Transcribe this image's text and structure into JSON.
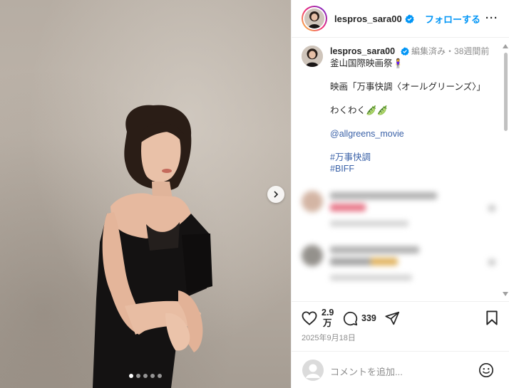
{
  "post": {
    "username": "lespros_sara00",
    "follow_label": "フォローする",
    "more_label": "···",
    "caption": {
      "meta": "編集済み・38週間前",
      "lines": [
        "釜山国際映画祭🧍‍♀️",
        "映画「万事快調〈オールグリーンズ〉」",
        "わくわく🫛🫛"
      ],
      "mention": "@allgreens_movie",
      "hashtags": [
        "#万事快調",
        "#BIFF"
      ]
    },
    "likes": [
      "2.9",
      "万"
    ],
    "comments_count": "339",
    "date": "2025年9月18日",
    "comment_placeholder": "コメントを追加..."
  },
  "carousel": {
    "slides": 5,
    "active": 0
  },
  "icons": {
    "verified": "verified-badge-icon",
    "heart": "heart-icon",
    "comment": "comment-icon",
    "share": "share-icon",
    "save": "bookmark-icon",
    "emoji": "emoji-icon",
    "next": "chevron-right-icon"
  },
  "colors": {
    "accent": "#0095f6",
    "link": "#3b62a8",
    "verified": "#0095f6"
  }
}
